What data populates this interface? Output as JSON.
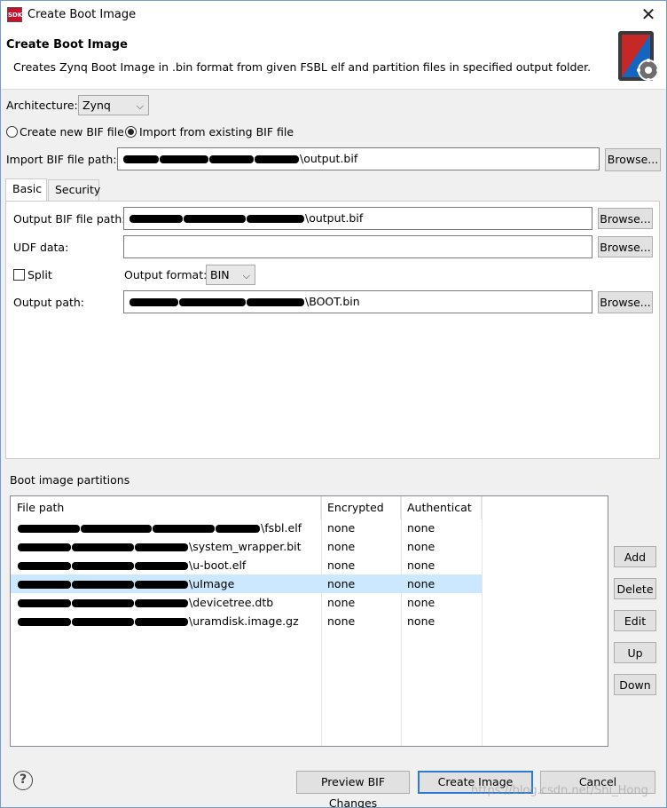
{
  "window": {
    "app_badge": "SDK",
    "title": "Create Boot Image",
    "close_glyph": "✕"
  },
  "header": {
    "title": "Create Boot Image",
    "description": "Creates Zynq Boot Image in .bin format from given FSBL elf and partition files in specified output folder.",
    "icon": "boot-image-gear-icon"
  },
  "architecture": {
    "label": "Architecture:",
    "value": "Zynq"
  },
  "bif_mode": {
    "create_label": "Create new BIF file",
    "import_label": "Import from existing BIF file",
    "selected": "import"
  },
  "import_bif": {
    "label": "Import BIF file path:",
    "value_suffix": "\\output.bif",
    "browse": "Browse..."
  },
  "tabs": [
    {
      "label": "Basic",
      "active": true
    },
    {
      "label": "Security",
      "active": false
    }
  ],
  "basic": {
    "output_bif_label": "Output BIF file path:",
    "output_bif_suffix": "\\output.bif",
    "udf_label": "UDF data:",
    "udf_value": "",
    "split_label": "Split",
    "output_format_label": "Output format:",
    "output_format_value": "BIN",
    "output_path_label": "Output path:",
    "output_path_suffix": "\\BOOT.bin",
    "browse": "Browse..."
  },
  "partitions": {
    "label": "Boot image partitions",
    "columns": [
      "File path",
      "Encrypted",
      "Authenticat"
    ],
    "rows": [
      {
        "path_suffix": "\\fsbl.elf",
        "encrypted": "none",
        "authenticated": "none"
      },
      {
        "path_suffix": "\\system_wrapper.bit",
        "encrypted": "none",
        "authenticated": "none"
      },
      {
        "path_suffix": "\\u-boot.elf",
        "encrypted": "none",
        "authenticated": "none"
      },
      {
        "path_suffix": "\\uImage",
        "encrypted": "none",
        "authenticated": "none"
      },
      {
        "path_suffix": "\\devicetree.dtb",
        "encrypted": "none",
        "authenticated": "none"
      },
      {
        "path_suffix": "\\uramdisk.image.gz",
        "encrypted": "none",
        "authenticated": "none"
      }
    ],
    "selected_row": 3,
    "buttons": {
      "add": "Add",
      "delete": "Delete",
      "edit": "Edit",
      "up": "Up",
      "down": "Down"
    }
  },
  "footer": {
    "help_glyph": "?",
    "preview": "Preview BIF Changes",
    "create": "Create Image",
    "cancel": "Cancel"
  },
  "watermark": "https://blog.csdn.net/Shi_Hong",
  "colors": {
    "accent": "#2b7bd6",
    "selection": "#cce8ff"
  }
}
